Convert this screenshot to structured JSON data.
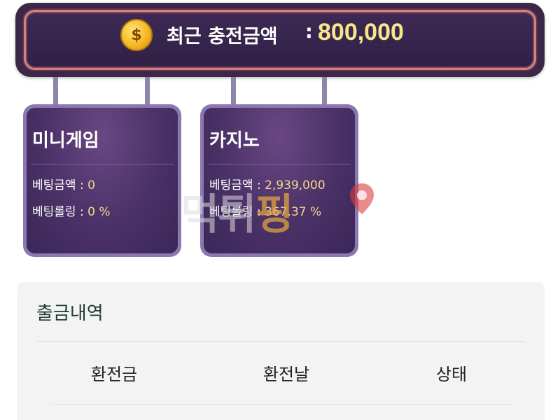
{
  "banner": {
    "icon": "dollar-coin-icon",
    "coin_symbol": "$",
    "label": "최근 충전금액",
    "separator": ":",
    "amount": "800,000"
  },
  "cards": [
    {
      "title": "미니게임",
      "bet_amount_label": "베팅금액",
      "bet_amount_value": "0",
      "rolling_label": "베팅롤링",
      "rolling_value": "0 %"
    },
    {
      "title": "카지노",
      "bet_amount_label": "베팅금액",
      "bet_amount_value": "2,939,000",
      "rolling_label": "베팅롤링",
      "rolling_value": "367.37 %"
    }
  ],
  "watermark": {
    "text_main": "먹튀",
    "text_accent": "핑",
    "icon": "location-pin-icon"
  },
  "withdrawal": {
    "title": "출금내역",
    "columns": [
      "환전금",
      "환전날",
      "상태"
    ]
  },
  "colors": {
    "banner_bg": "#3b2748",
    "banner_border": "#d9807a",
    "amount_text": "#f7e58a",
    "card_bg": "#4a3166",
    "card_border": "#8a78b0",
    "card_value": "#f2d98a",
    "panel_bg": "#f3f3f3"
  }
}
